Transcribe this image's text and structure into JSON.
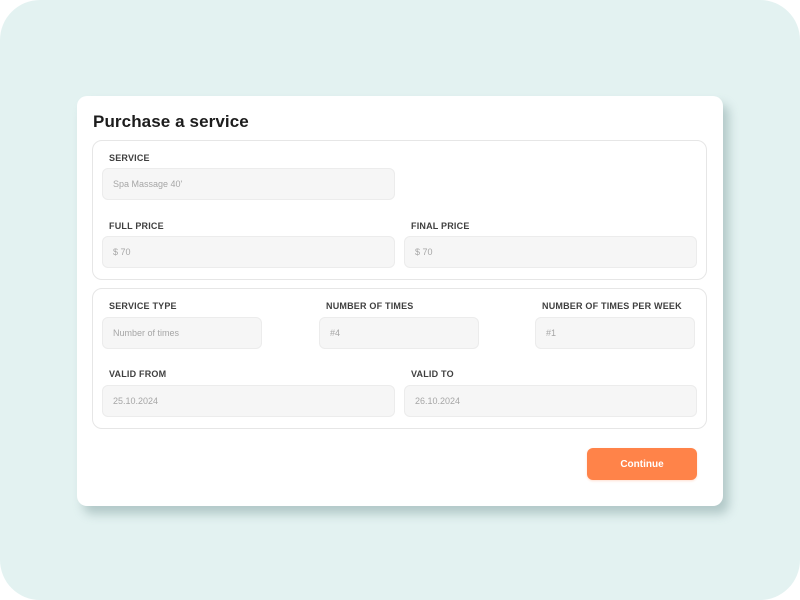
{
  "title": "Purchase a service",
  "colors": {
    "backdrop": "#e3f2f1",
    "card": "#ffffff",
    "field_bg": "#f6f6f6",
    "accent": "#ff8349"
  },
  "service_panel": {
    "service": {
      "label": "SERVICE",
      "value": "Spa Massage 40'"
    },
    "full_price": {
      "label": "FULL PRICE",
      "value": "$ 70"
    },
    "final_price": {
      "label": "FINAL PRICE",
      "value": "$ 70"
    }
  },
  "details_panel": {
    "service_type": {
      "label": "SERVICE TYPE",
      "value": "Number of times"
    },
    "number_of_times": {
      "label": "NUMBER OF TIMES",
      "value": "#4"
    },
    "times_per_week": {
      "label": "NUMBER OF TIMES PER WEEK",
      "value": "#1"
    },
    "valid_from": {
      "label": "VALID FROM",
      "value": "25.10.2024"
    },
    "valid_to": {
      "label": "VALID TO",
      "value": "26.10.2024"
    }
  },
  "actions": {
    "continue_label": "Continue"
  }
}
